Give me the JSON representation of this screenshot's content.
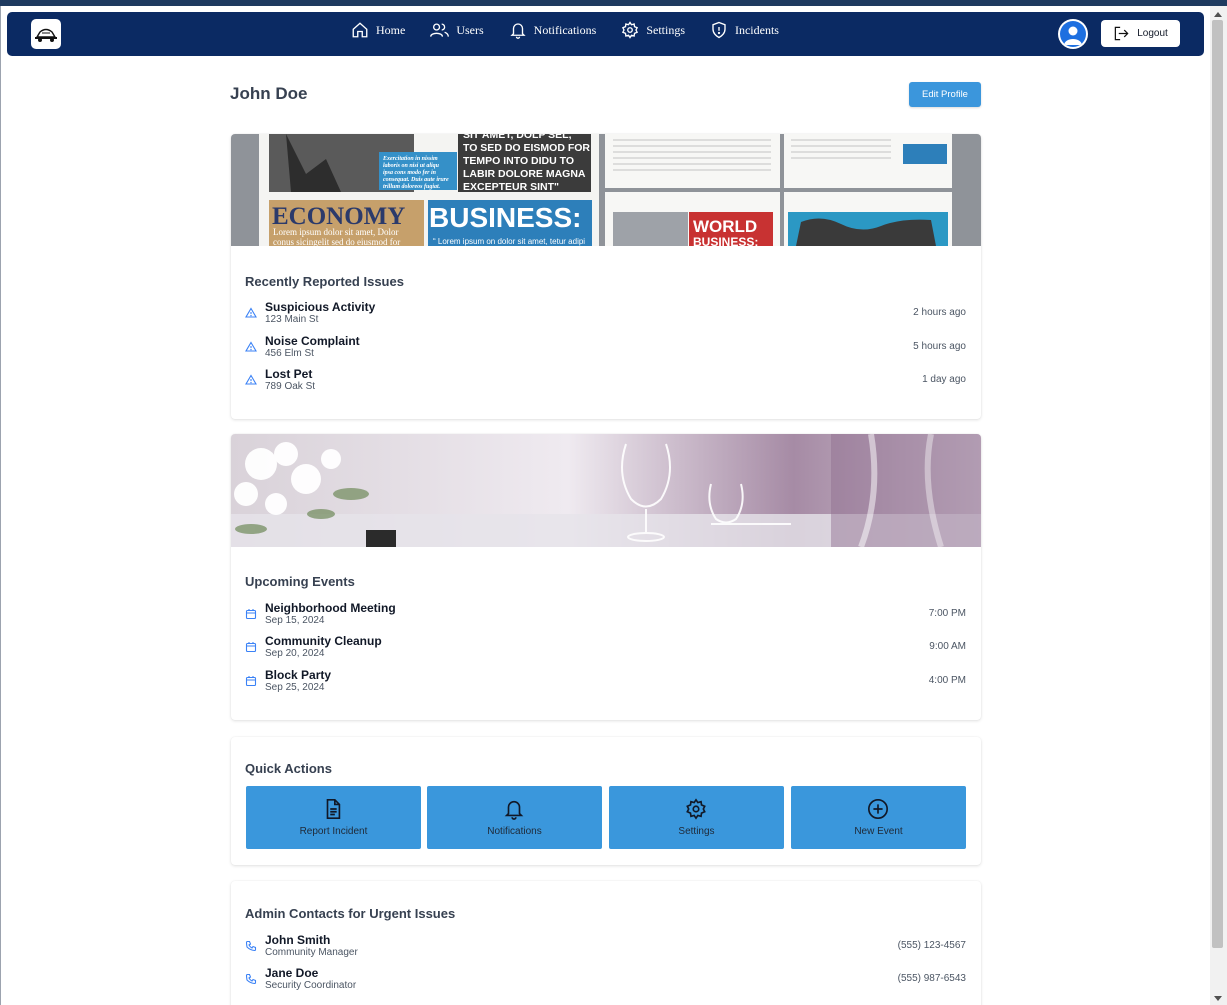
{
  "nav": {
    "links": [
      {
        "label": "Home",
        "icon": "home-icon"
      },
      {
        "label": "Users",
        "icon": "users-icon"
      },
      {
        "label": "Notifications",
        "icon": "bell-icon"
      },
      {
        "label": "Settings",
        "icon": "gear-icon"
      },
      {
        "label": "Incidents",
        "icon": "shield-alert-icon"
      }
    ],
    "logout_label": "Logout"
  },
  "profile": {
    "name": "John Doe",
    "edit_label": "Edit Profile"
  },
  "issues": {
    "title": "Recently Reported Issues",
    "items": [
      {
        "title": "Suspicious Activity",
        "address": "123 Main St",
        "time": "2 hours ago"
      },
      {
        "title": "Noise Complaint",
        "address": "456 Elm St",
        "time": "5 hours ago"
      },
      {
        "title": "Lost Pet",
        "address": "789 Oak St",
        "time": "1 day ago"
      }
    ],
    "banner": {
      "headline_top": "TO SED DO EISMOD FOR TEMPO INTO DIDU TO LABIR DOLORE MAGNA EXCEPTEUR SINT",
      "economy": "ECONOMY",
      "business": "BUSINESS:",
      "world_business": "WORLD BUSINESS:",
      "lorem_left": "Lorem ipsum dolor sit amet, Dolor conus sicingelit sed do eiusmod for",
      "lorem_right": "Lorem ipsum on dolor sit amet, tetur adipi"
    }
  },
  "events": {
    "title": "Upcoming Events",
    "items": [
      {
        "title": "Neighborhood Meeting",
        "date": "Sep 15, 2024",
        "time": "7:00 PM"
      },
      {
        "title": "Community Cleanup",
        "date": "Sep 20, 2024",
        "time": "9:00 AM"
      },
      {
        "title": "Block Party",
        "date": "Sep 25, 2024",
        "time": "4:00 PM"
      }
    ]
  },
  "quick_actions": {
    "title": "Quick Actions",
    "buttons": [
      {
        "label": "Report Incident",
        "icon": "document-icon"
      },
      {
        "label": "Notifications",
        "icon": "bell-icon"
      },
      {
        "label": "Settings",
        "icon": "gear-icon"
      },
      {
        "label": "New Event",
        "icon": "plus-circle-icon"
      }
    ]
  },
  "contacts": {
    "title": "Admin Contacts for Urgent Issues",
    "items": [
      {
        "name": "John Smith",
        "role": "Community Manager",
        "phone": "(555) 123-4567"
      },
      {
        "name": "Jane Doe",
        "role": "Security Coordinator",
        "phone": "(555) 987-6543"
      }
    ]
  },
  "colors": {
    "navbar": "#0b2a63",
    "primary_button": "#3a97dc",
    "accent_icon": "#3b82f6"
  }
}
